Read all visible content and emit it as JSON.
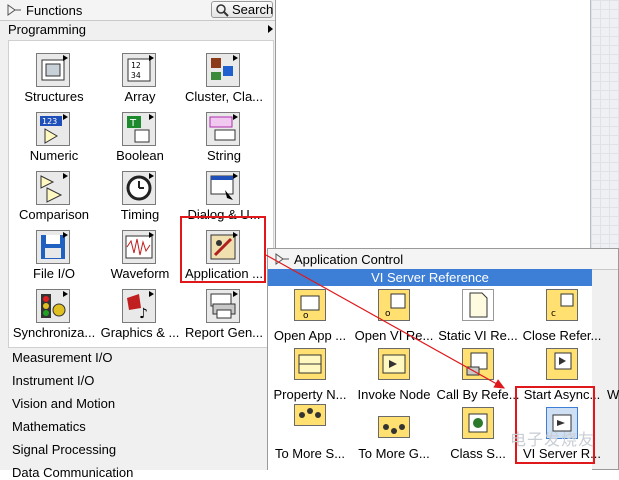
{
  "functions_palette": {
    "title": "Functions",
    "search_label": "Search",
    "category": "Programming",
    "items": [
      {
        "label": "Structures"
      },
      {
        "label": "Array"
      },
      {
        "label": "Cluster, Cla..."
      },
      {
        "label": "Numeric"
      },
      {
        "label": "Boolean"
      },
      {
        "label": "String"
      },
      {
        "label": "Comparison"
      },
      {
        "label": "Timing"
      },
      {
        "label": "Dialog & U..."
      },
      {
        "label": "File I/O"
      },
      {
        "label": "Waveform"
      },
      {
        "label": "Application ..."
      },
      {
        "label": "Synchroniza..."
      },
      {
        "label": "Graphics & ..."
      },
      {
        "label": "Report Gen..."
      }
    ],
    "menu": [
      "Measurement I/O",
      "Instrument I/O",
      "Vision and Motion",
      "Mathematics",
      "Signal Processing",
      "Data Communication"
    ]
  },
  "app_control": {
    "title": "Application Control",
    "section": "VI Server Reference",
    "items": [
      {
        "label": "Open App ..."
      },
      {
        "label": "Open VI Re..."
      },
      {
        "label": "Static VI Re..."
      },
      {
        "label": "Close Refer..."
      },
      {
        "label": "Property N..."
      },
      {
        "label": "Invoke Node"
      },
      {
        "label": "Call By Refe..."
      },
      {
        "label": "Start Async..."
      },
      {
        "label": "To More S..."
      },
      {
        "label": "To More G..."
      },
      {
        "label": "Class S..."
      },
      {
        "label": "VI Server R..."
      }
    ],
    "overflow_letter": "W"
  },
  "watermark": "电子发烧友",
  "colors": {
    "highlight": "#e0181c",
    "section_bar": "#3d7fd6",
    "palette_bg": "#f0f0f0"
  }
}
